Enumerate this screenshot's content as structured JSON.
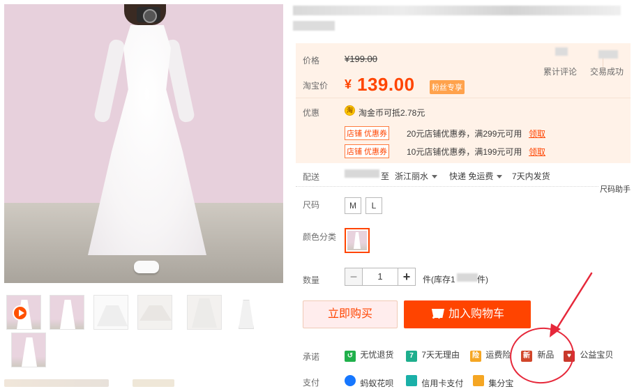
{
  "product": {
    "price_label": "价格",
    "original_price": "¥199.00",
    "taobao_price_label": "淘宝价",
    "currency_symbol": "¥",
    "current_price": "139.00",
    "fan_tag": "粉丝专享",
    "stats": {
      "reviews_label": "累计评论",
      "sales_label": "交易成功"
    }
  },
  "discounts": {
    "label": "优惠",
    "coin_icon": "coin-icon",
    "coin_symbol": "淘",
    "coin_text": "淘金币可抵2.78元",
    "coupons": [
      {
        "tag": "店铺 优惠券",
        "text": "20元店铺优惠券，满299元可用",
        "claim": "领取"
      },
      {
        "tag": "店铺 优惠券",
        "text": "10元店铺优惠券，满199元可用",
        "claim": "领取"
      }
    ]
  },
  "delivery": {
    "label": "配送",
    "to": "至",
    "destination": "浙江丽水",
    "shipping": "快递 免运费",
    "ship_time": "7天内发货",
    "size_helper": "尺码助手"
  },
  "size": {
    "label": "尺码",
    "options": [
      "M",
      "L"
    ]
  },
  "color": {
    "label": "颜色分类"
  },
  "quantity": {
    "label": "数量",
    "minus": "−",
    "value": "1",
    "plus": "+",
    "stock_prefix": "件(库存1",
    "stock_suffix": "件)"
  },
  "actions": {
    "buy_now": "立即购买",
    "add_to_cart": "加入购物车"
  },
  "promise": {
    "label": "承诺",
    "items": [
      {
        "icon": "worry-free-return-icon",
        "color": "#20b04b",
        "glyph": "↺",
        "text": "无忧退货"
      },
      {
        "icon": "seven-day-return-icon",
        "color": "#1eae8d",
        "glyph": "7",
        "text": "7天无理由"
      },
      {
        "icon": "shipping-insurance-icon",
        "color": "#f5a623",
        "glyph": "险",
        "text": "运费险"
      },
      {
        "icon": "new-item-icon",
        "color": "#ff4400",
        "glyph": "新",
        "text": "新品"
      },
      {
        "icon": "charity-icon",
        "color": "#e0493a",
        "glyph": "♥",
        "text": "公益宝贝"
      }
    ]
  },
  "payment": {
    "label": "支付",
    "items": [
      {
        "icon": "huabei-icon",
        "color": "#1677ff",
        "text": "蚂蚁花呗"
      },
      {
        "icon": "credit-card-icon",
        "color": "#1ab0a8",
        "text": "信用卡支付"
      },
      {
        "icon": "jifenbao-icon",
        "color": "#f5a623",
        "text": "集分宝"
      }
    ]
  },
  "colors": {
    "accent": "#ff4400",
    "price_bg": "#fff2e8",
    "annotation": "#e6283a"
  }
}
